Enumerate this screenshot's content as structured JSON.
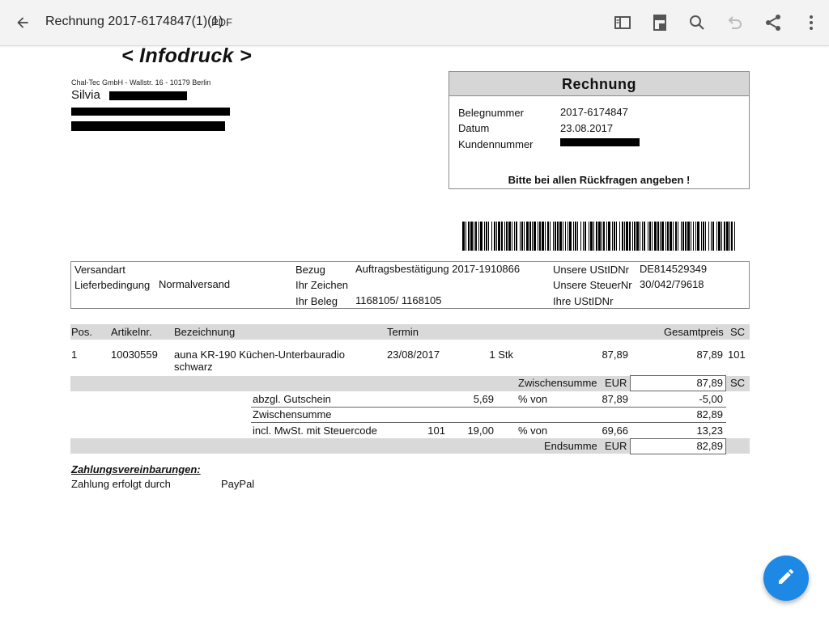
{
  "appbar": {
    "title": "Rechnung 2017-6174847(1)(1)",
    "file_type": "PDF",
    "icons": [
      "back-arrow-icon",
      "sidebar-toggle-icon",
      "page-view-icon",
      "search-icon",
      "undo-icon",
      "share-icon",
      "more-vert-icon"
    ]
  },
  "doc": {
    "logo": "< Infodruck >",
    "sender_line": "Chal-Tec GmbH - Wallstr. 16 - 10179 Berlin",
    "recipient_name": "Silvia",
    "invoice_box": {
      "title": "Rechnung",
      "fields": [
        {
          "label": "Belegnummer",
          "value": "2017-6174847"
        },
        {
          "label": "Datum",
          "value": "23.08.2017"
        },
        {
          "label": "Kundennummer",
          "value": ""
        }
      ],
      "note": "Bitte bei allen Rückfragen angeben !"
    },
    "info": {
      "versandart_label": "Versandart",
      "lieferbedingung_label": "Lieferbedingung",
      "lieferbedingung_value": "Normalversand",
      "bezug_label": "Bezug",
      "bezug_value": "Auftragsbestätigung 2017-1910866",
      "ihr_zeichen_label": "Ihr Zeichen",
      "ihr_beleg_label": "Ihr Beleg",
      "ihr_beleg_value": "1168105/ 1168105",
      "ust_label": "Unsere UStIDNr",
      "ust_value": "DE814529349",
      "steuer_label": "Unsere SteuerNr",
      "steuer_value": "30/042/79618",
      "ihre_ust_label": "Ihre UStIDNr"
    },
    "table": {
      "headers": {
        "pos": "Pos.",
        "artikel": "Artikelnr.",
        "bezeichnung": "Bezeichnung",
        "termin": "Termin",
        "gesamt": "Gesamtpreis",
        "sc": "SC"
      },
      "row": {
        "pos": "1",
        "artikel": "10030559",
        "bez_line1": "auna KR-190 Küchen-Unterbauradio",
        "bez_line2": "schwarz",
        "termin": "23/08/2017",
        "qty": "1 Stk",
        "price": "87,89",
        "total": "87,89",
        "sc": "101"
      },
      "zwischensumme1": {
        "label": "Zwischensumme",
        "cur": "EUR",
        "value": "87,89",
        "sc": "SC"
      },
      "gutschein": {
        "label": "abzgl. Gutschein",
        "amount": "5,69",
        "pct_label": "% von",
        "base": "87,89",
        "value": "-5,00"
      },
      "zwischensumme2": {
        "label": "Zwischensumme",
        "value": "82,89"
      },
      "mwst": {
        "label": "incl. MwSt. mit Steuercode",
        "code": "101",
        "rate": "19,00",
        "pct_label": "% von",
        "base": "69,66",
        "value": "13,23"
      },
      "endsumme": {
        "label": "Endsumme",
        "cur": "EUR",
        "value": "82,89"
      }
    },
    "payment": {
      "heading": "Zahlungsvereinbarungen:",
      "label": "Zahlung erfolgt durch",
      "value": "PayPal"
    }
  },
  "fab": {
    "icon": "edit-pencil-icon"
  }
}
